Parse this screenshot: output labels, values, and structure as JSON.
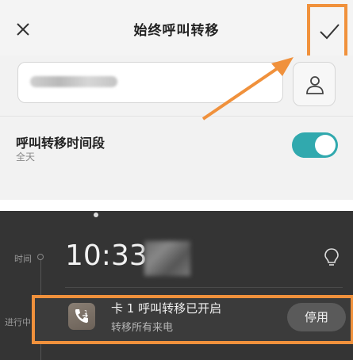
{
  "header": {
    "title": "始终呼叫转移"
  },
  "forward_number": {
    "placeholder": "",
    "value": ""
  },
  "time_period": {
    "label": "呼叫转移时间段",
    "value": "全天",
    "toggle_on": true
  },
  "lockscreen": {
    "clock": "10:33",
    "timeline_labels": [
      "时间",
      "进行中"
    ]
  },
  "notification": {
    "title": "卡 1 呼叫转移已开启",
    "subtitle": "转移所有来电",
    "button_label": "停用"
  },
  "colors": {
    "accent": "#31a9ae",
    "highlight": "#f0913c",
    "dark_bg": "#343434"
  },
  "icons": {
    "close": "close-icon",
    "confirm": "checkmark-icon",
    "contact": "person-icon",
    "bulb": "lightbulb-icon",
    "forward": "call-forward-icon"
  }
}
